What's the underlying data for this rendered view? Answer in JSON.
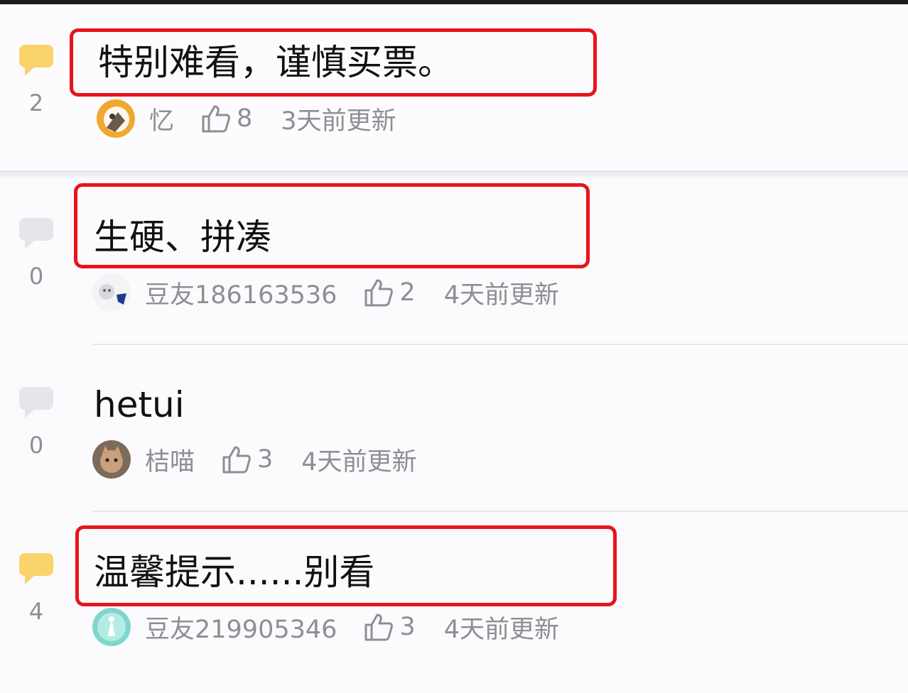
{
  "posts": [
    {
      "title": "特别难看，谨慎买票。",
      "reply_count": "2",
      "user": "忆",
      "likes": "8",
      "time": "3天前更新",
      "reply_icon_color": "#fbd36b",
      "highlighted": true
    },
    {
      "title": "生硬、拼凑",
      "reply_count": "0",
      "user": "豆友186163536",
      "likes": "2",
      "time": "4天前更新",
      "reply_icon_color": "#e6e6ea",
      "highlighted": true
    },
    {
      "title": "hetui",
      "reply_count": "0",
      "user": "桔喵",
      "likes": "3",
      "time": "4天前更新",
      "reply_icon_color": "#e6e6ea",
      "highlighted": false
    },
    {
      "title": "温馨提示......别看",
      "reply_count": "4",
      "user": "豆友219905346",
      "likes": "3",
      "time": "4天前更新",
      "reply_icon_color": "#fbd36b",
      "highlighted": true
    }
  ],
  "icons": {
    "reply": "speech-bubble-icon",
    "like": "thumbs-up-icon"
  },
  "colors": {
    "highlight_border": "#e8141c",
    "meta_text": "#8e8e93"
  }
}
